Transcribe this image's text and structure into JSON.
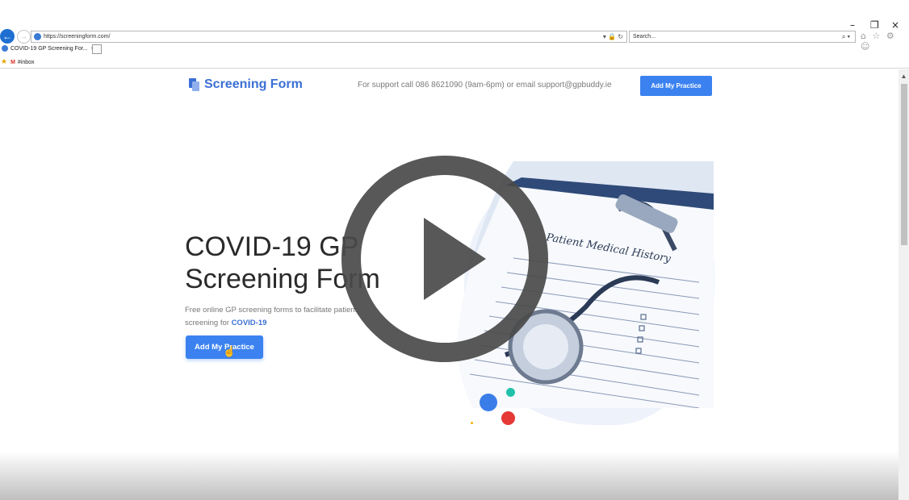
{
  "browser": {
    "url": "https://screeningform.com/",
    "search_placeholder": "Search...",
    "tab_title": "COVID-19 GP Screening For...",
    "tab_close": "×",
    "favorites_item": "#inbox",
    "window_controls": [
      "–",
      "❐",
      "×"
    ],
    "address_controls": "▾ 🔒 ↻",
    "search_icon": "⌕ ▾",
    "toolbar_icons": "⌂ ☆ ⚙ ☺"
  },
  "site": {
    "brand": "Screening Form",
    "support_text": "For support call 086 8621090 (9am-6pm) or email support@gpbuddy.ie",
    "nav_cta": "Add My Practice",
    "hero": {
      "title_line1": "COVID-19 GP",
      "title_line2": "Screening Form",
      "subtitle_part1": "Free online GP screening forms to facilitate patient",
      "subtitle_part2": "screening for",
      "subtitle_highlight": "COVID-19",
      "cta": "Add My Practice"
    },
    "image_text": "Patient Medical History"
  },
  "overlay": {
    "icon": "play-icon"
  },
  "colors": {
    "accent": "#3b82f0",
    "brand": "#3b6fd4",
    "overlay_dark": "#4a4a4a"
  }
}
